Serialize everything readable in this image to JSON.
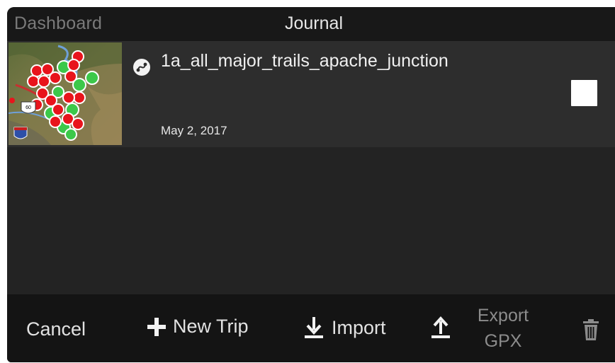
{
  "header": {
    "back_label": "Dashboard",
    "title": "Journal"
  },
  "trips": [
    {
      "name": "1a_all_major_trails_apache_junction",
      "date": "May 2, 2017",
      "icon": "route-icon",
      "selected": false
    }
  ],
  "toolbar": {
    "cancel_label": "Cancel",
    "new_trip_label": "New Trip",
    "import_label": "Import",
    "export_label_line1": "Export",
    "export_label_line2": "GPX",
    "delete_icon": "trash-icon"
  },
  "colors": {
    "background": "#232323",
    "header": "#181818",
    "row": "#2d2d2d",
    "toolbar": "#141414",
    "text": "#e6e6e6",
    "disabled_text": "#8c8c8c",
    "marker_red": "#e8141c",
    "marker_green": "#3cc84a"
  }
}
